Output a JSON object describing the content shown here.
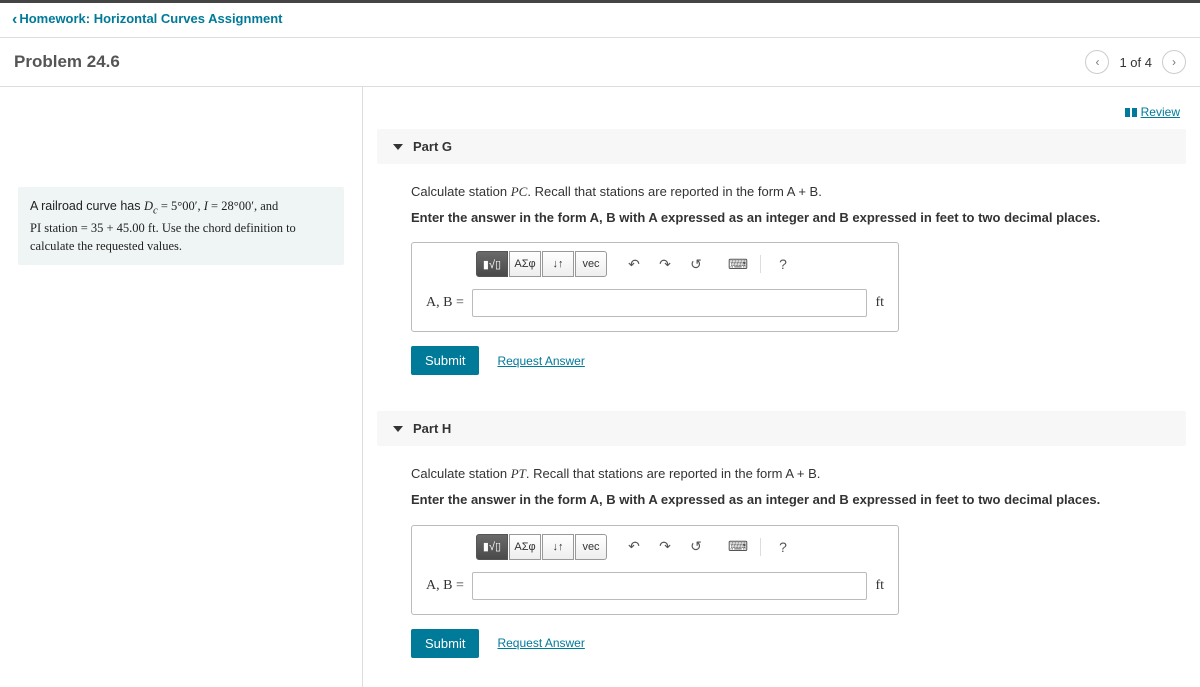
{
  "breadcrumb": {
    "label": "Homework: Horizontal Curves Assignment"
  },
  "header": {
    "title": "Problem 24.6",
    "counter": "1 of 4"
  },
  "review_link": "Review",
  "left": {
    "line1a": "A railroad curve has ",
    "dc": "Dc",
    "eq1": " = 5°00′, ",
    "ivar": "I",
    "eq2": " = 28°00′, and ",
    "line2a": "PI station",
    "line2b": " = 35 + 45.00 ft. Use the chord definition to calculate the requested values."
  },
  "parts": [
    {
      "title": "Part G",
      "instr1a": "Calculate station ",
      "instr1var": "PC",
      "instr1b": ". Recall that stations are reported in the form A + B.",
      "instr2": "Enter the answer in the form A, B with A expressed as an integer and B expressed in feet to two decimal places.",
      "label": "A, B =",
      "unit": "ft",
      "submit": "Submit",
      "request": "Request Answer"
    },
    {
      "title": "Part H",
      "instr1a": "Calculate station ",
      "instr1var": "PT",
      "instr1b": ". Recall that stations are reported in the form A + B.",
      "instr2": "Enter the answer in the form A, B with A expressed as an integer and B expressed in feet to two decimal places.",
      "label": "A, B =",
      "unit": "ft",
      "submit": "Submit",
      "request": "Request Answer"
    }
  ],
  "toolbar": {
    "templates_hint": "▮√▯",
    "greek": "ΑΣφ",
    "subsup": "↓↑",
    "vec": "vec",
    "undo": "↶",
    "redo": "↷",
    "reset": "↺",
    "keyboard": "⌨",
    "help": "?"
  }
}
